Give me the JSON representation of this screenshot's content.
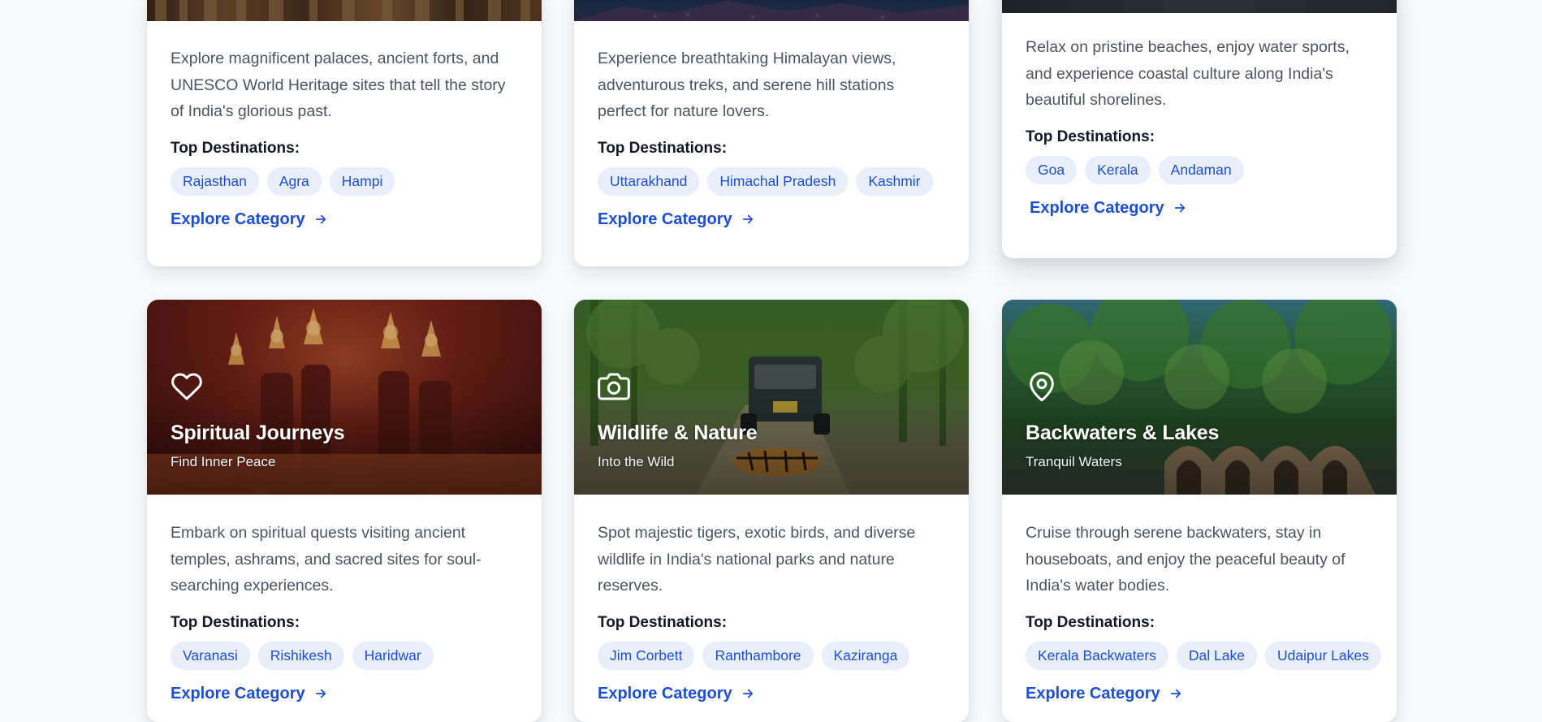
{
  "colors": {
    "page_bg": "#f8fafc",
    "card_bg": "#ffffff",
    "accent": "#1d4ed8",
    "tag_bg": "#e8effb",
    "text_muted": "#4b5563",
    "text_strong": "#111827"
  },
  "labels": {
    "top_destinations": "Top Destinations:",
    "explore_category": "Explore Category"
  },
  "cards": [
    {
      "title": "",
      "subtitle": "",
      "icon": "",
      "description": "Explore magnificent palaces, ancient forts, and UNESCO World Heritage sites that tell the story of India's glorious past.",
      "destinations": [
        "Rajasthan",
        "Agra",
        "Hampi"
      ]
    },
    {
      "title": "",
      "subtitle": "",
      "icon": "",
      "description": "Experience breathtaking Himalayan views, adventurous treks, and serene hill stations perfect for nature lovers.",
      "destinations": [
        "Uttarakhand",
        "Himachal Pradesh",
        "Kashmir"
      ]
    },
    {
      "title": "",
      "subtitle": "",
      "icon": "",
      "description": "Relax on pristine beaches, enjoy water sports, and experience coastal culture along India's beautiful shorelines.",
      "destinations": [
        "Goa",
        "Kerala",
        "Andaman"
      ]
    },
    {
      "title": "Spiritual Journeys",
      "subtitle": "Find Inner Peace",
      "icon": "heart-icon",
      "description": "Embark on spiritual quests visiting ancient temples, ashrams, and sacred sites for soul-searching experiences.",
      "destinations": [
        "Varanasi",
        "Rishikesh",
        "Haridwar"
      ]
    },
    {
      "title": "Wildlife & Nature",
      "subtitle": "Into the Wild",
      "icon": "camera-icon",
      "description": "Spot majestic tigers, exotic birds, and diverse wildlife in India's national parks and nature reserves.",
      "destinations": [
        "Jim Corbett",
        "Ranthambore",
        "Kaziranga"
      ]
    },
    {
      "title": "Backwaters & Lakes",
      "subtitle": "Tranquil Waters",
      "icon": "map-pin-icon",
      "description": "Cruise through serene backwaters, stay in houseboats, and enjoy the peaceful beauty of India's water bodies.",
      "destinations": [
        "Kerala Backwaters",
        "Dal Lake",
        "Udaipur Lakes"
      ]
    }
  ]
}
